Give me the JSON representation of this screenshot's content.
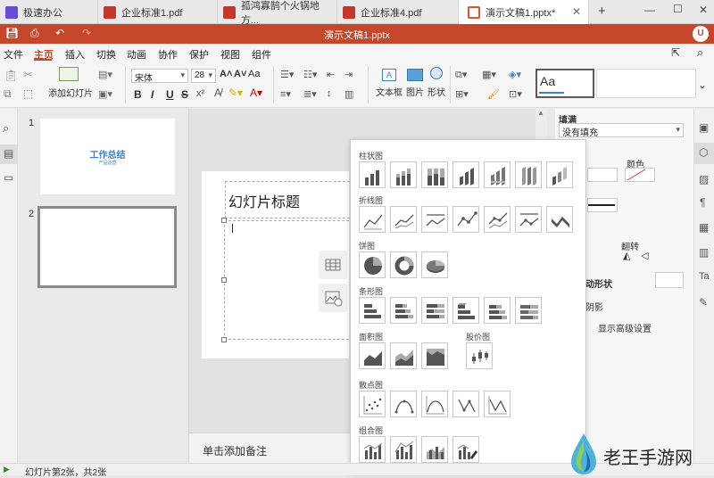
{
  "tabs": [
    {
      "label": "极速办公",
      "icon": "wps-logo-icon"
    },
    {
      "label": "企业标准1.pdf",
      "icon": "pdf-icon"
    },
    {
      "label": "孤鸿寡鹄个火锅地方...",
      "icon": "pdf-icon"
    },
    {
      "label": "企业标准4.pdf",
      "icon": "pdf-icon"
    },
    {
      "label": "演示文稿1.pptx*",
      "icon": "presentation-icon"
    }
  ],
  "window": {
    "title": "演示文稿1.pptx",
    "user_initial": "U"
  },
  "menu": [
    "文件",
    "主页",
    "插入",
    "切换",
    "动画",
    "协作",
    "保护",
    "视图",
    "组件"
  ],
  "menu_active": "主页",
  "ribbon": {
    "add_slide": "添加幻灯片",
    "font_name": "宋体",
    "font_size": "28",
    "grow": "A˄",
    "shrink": "A˅",
    "case": "Aa",
    "bold": "B",
    "italic": "I",
    "underline": "U",
    "strike": "S",
    "textbox": "文本框",
    "picture": "图片",
    "shape": "形状",
    "style_preview": "Aa"
  },
  "thumbnails": [
    {
      "num": "1",
      "title": "工作总结",
      "subtitle": "产品运营"
    },
    {
      "num": "2"
    }
  ],
  "slide": {
    "title": "幻灯片标题",
    "notes": "单击添加备注"
  },
  "chart_popup": {
    "sections": [
      "柱状图",
      "折线图",
      "饼图",
      "条形图",
      "面积图",
      "股价图",
      "散点图",
      "组合图"
    ]
  },
  "props": {
    "fill_label": "填满",
    "fill_value": "没有填充",
    "color_label": "颜色",
    "rotate_label": "翻转",
    "shape_label": "动形状",
    "shadow_label": "阴影",
    "advanced": "显示高级设置"
  },
  "status": {
    "text": "幻灯片第2张，共2张"
  },
  "watermark": {
    "text": "老王手游网"
  },
  "colors": {
    "accent": "#c4472b",
    "chart_gray": "#555555"
  }
}
